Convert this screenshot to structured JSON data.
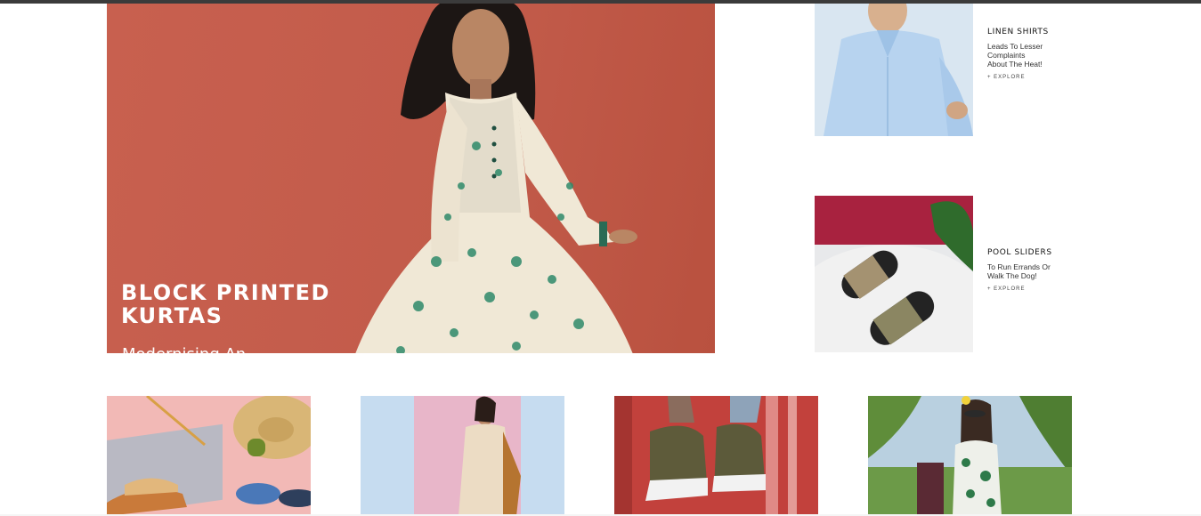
{
  "hero": {
    "title_line1": "BLOCK PRINTED",
    "title_line2": "KURTAS",
    "subtitle": "Modernising An"
  },
  "promos": [
    {
      "title": "LINEN SHIRTS",
      "desc_lines": [
        "Leads To Lesser",
        "Complaints",
        "About The Heat!"
      ],
      "link": "+ EXPLORE"
    },
    {
      "title": "POOL SLIDERS",
      "desc_lines": [
        "To Run Errands Or",
        "Walk The Dog!"
      ],
      "link": "+ EXPLORE"
    }
  ],
  "tiles": [
    {
      "name": "footwear-flatlay"
    },
    {
      "name": "dress-model"
    },
    {
      "name": "sneakers"
    },
    {
      "name": "resort-wear"
    }
  ],
  "colors": {
    "hero_bg": "#c25b4a",
    "text_dark": "#111111",
    "topbar": "#3b3b3b"
  }
}
